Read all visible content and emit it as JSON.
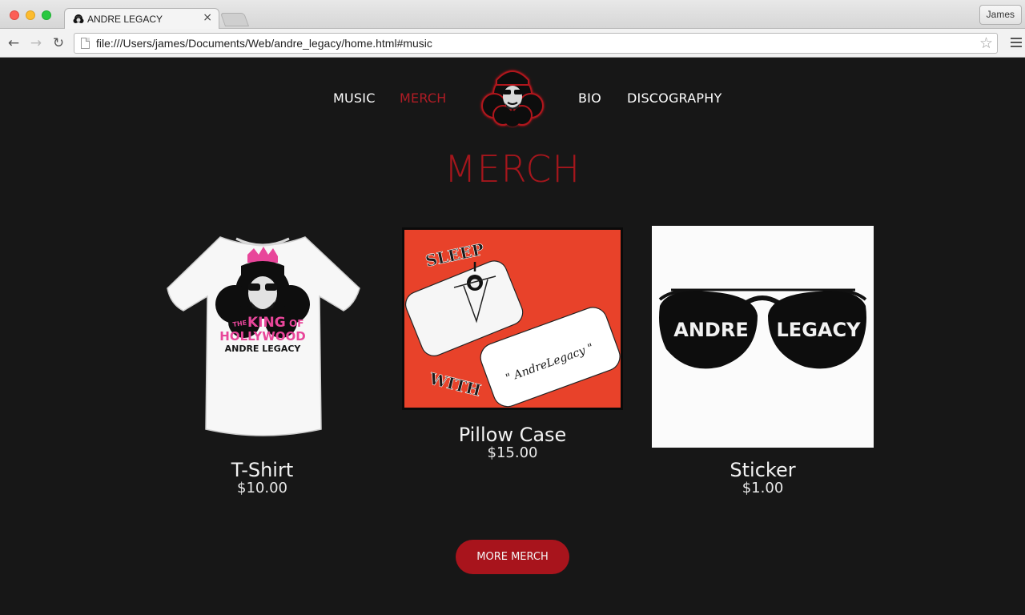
{
  "browser": {
    "tab_title": "ANDRE LEGACY",
    "tab_close": "×",
    "profile_name": "James",
    "url": "file:///Users/james/Documents/Web/andre_legacy/home.html#music",
    "back_glyph": "←",
    "forward_glyph": "→",
    "reload_glyph": "↻",
    "star_glyph": "☆"
  },
  "nav": {
    "items": [
      {
        "label": "MUSIC",
        "active": false
      },
      {
        "label": "MERCH",
        "active": true
      },
      {
        "label": "BIO",
        "active": false
      },
      {
        "label": "DISCOGRAPHY",
        "active": false
      }
    ],
    "logo_icon": "andre-legacy-portrait-logo"
  },
  "section": {
    "title": "MERCH"
  },
  "products": [
    {
      "name": "T-Shirt",
      "price": "$10.00",
      "image_text": [
        "THE",
        "KING",
        "OF",
        "HOLLYWOOD",
        "ANDRE LEGACY"
      ]
    },
    {
      "name": "Pillow Case",
      "price": "$15.00",
      "image_text": [
        "SLEEP",
        "WITH",
        "\" AndreLegacy \""
      ]
    },
    {
      "name": "Sticker",
      "price": "$1.00",
      "image_text": [
        "ANDRE",
        "LEGACY"
      ]
    }
  ],
  "more_button": {
    "label": "MORE MERCH"
  },
  "colors": {
    "background": "#171717",
    "accent": "#a8141c",
    "active_nav": "#b01c25",
    "text": "#ffffff",
    "tshirt_pink": "#e8469a",
    "pillow_bg": "#e8422a"
  }
}
